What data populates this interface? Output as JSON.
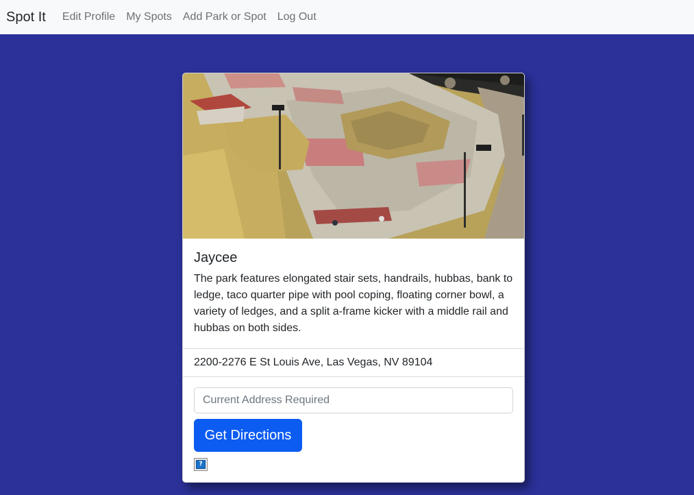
{
  "nav": {
    "brand": "Spot It",
    "links": [
      "Edit Profile",
      "My Spots",
      "Add Park or Spot",
      "Log Out"
    ]
  },
  "park": {
    "name": "Jaycee",
    "description": "The park features elongated stair sets, handrails, hubbas, bank to ledge, taco quarter pipe with pool coping, floating corner bowl, a variety of ledges, and a split a-frame kicker with a middle rail and hubbas on both sides.",
    "address": "2200-2276 E St Louis Ave, Las Vegas, NV 89104"
  },
  "directions": {
    "input_placeholder": "Current Address Required",
    "input_value": "",
    "button_label": "Get Directions",
    "help_icon_glyph": "?"
  },
  "colors": {
    "page_background": "#2b3199",
    "navbar_background": "#f8f9fa",
    "primary_button": "#0d5cf2"
  },
  "icons": {
    "help": "help-icon"
  }
}
